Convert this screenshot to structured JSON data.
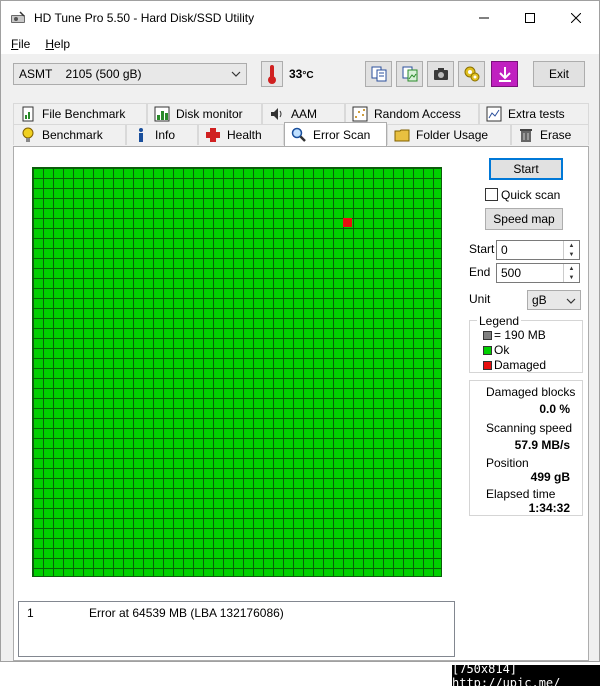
{
  "window": {
    "title": "HD Tune Pro 5.50 - Hard Disk/SSD Utility"
  },
  "menu": {
    "file_rest": "ile",
    "file_key": "F",
    "help_rest": "elp",
    "help_key": "H"
  },
  "toolbar": {
    "drive": "ASMT    2105 (500 gB)",
    "temperature": "33",
    "temperature_unit": "°C",
    "exit_label": "Exit"
  },
  "tabs": {
    "row1": [
      {
        "label": "File Benchmark",
        "icon": "file-benchmark-icon"
      },
      {
        "label": "Disk monitor",
        "icon": "disk-monitor-icon"
      },
      {
        "label": "AAM",
        "icon": "speaker-icon"
      },
      {
        "label": "Random Access",
        "icon": "random-access-icon"
      },
      {
        "label": "Extra tests",
        "icon": "extra-tests-icon"
      }
    ],
    "row2": [
      {
        "label": "Benchmark",
        "icon": "lightbulb-icon"
      },
      {
        "label": "Info",
        "icon": "info-icon"
      },
      {
        "label": "Health",
        "icon": "health-cross-icon"
      },
      {
        "label": "Error Scan",
        "icon": "magnifier-icon",
        "active": true
      },
      {
        "label": "Folder Usage",
        "icon": "folder-icon"
      },
      {
        "label": "Erase",
        "icon": "trash-icon"
      }
    ]
  },
  "controls": {
    "start_label": "Start",
    "quick_scan_label": "Quick scan",
    "quick_scan_checked": false,
    "speed_map_label": "Speed map",
    "start_field_label": "Start",
    "start_value": "0",
    "end_field_label": "End",
    "end_value": "500",
    "unit_label": "Unit",
    "unit_value": "gB"
  },
  "legend": {
    "title": "Legend",
    "block_size": "= 190 MB",
    "ok": "Ok",
    "damaged": "Damaged",
    "colors": {
      "block": "#808080",
      "ok": "#00d000",
      "damaged": "#e81010"
    }
  },
  "stats": {
    "damaged_blocks_label": "Damaged blocks",
    "damaged_blocks_value": "0.0 %",
    "scanning_speed_label": "Scanning speed",
    "scanning_speed_value": "57.9 MB/s",
    "position_label": "Position",
    "position_value": "499 gB",
    "elapsed_label": "Elapsed time",
    "elapsed_value": "1:34:32"
  },
  "scan_grid": {
    "columns": 41,
    "rows": 41,
    "damaged_blocks": [
      {
        "column": 31,
        "row": 5
      }
    ]
  },
  "log": [
    {
      "index": "1",
      "message": "Error at 64539 MB (LBA 132176086)"
    }
  ],
  "watermark": "[750x814] http://upic.me/"
}
